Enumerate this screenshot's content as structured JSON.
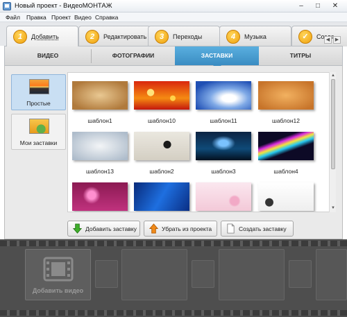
{
  "window": {
    "title": "Новый проект - ВидеоМОНТАЖ",
    "minimize_glyph": "–",
    "maximize_glyph": "□",
    "close_glyph": "✕"
  },
  "menu": {
    "items": [
      {
        "label": "Файл"
      },
      {
        "label": "Правка"
      },
      {
        "label": "Проект"
      },
      {
        "label": "Видео"
      },
      {
        "label": "Справка"
      }
    ]
  },
  "main_tabs": [
    {
      "number": "1",
      "label": "Добавить",
      "active": true
    },
    {
      "number": "2",
      "label": "Редактировать",
      "active": false
    },
    {
      "number": "3",
      "label": "Переходы",
      "active": false
    },
    {
      "number": "4",
      "label": "Музыка",
      "active": false
    },
    {
      "number": "",
      "label": "Созда",
      "active": false,
      "icon": "check-icon"
    }
  ],
  "tab_scroll": {
    "left_glyph": "◀",
    "right_glyph": "▶"
  },
  "sub_tabs": [
    {
      "label": "ВИДЕО",
      "active": false
    },
    {
      "label": "ФОТОГРАФИИ",
      "active": false
    },
    {
      "label": "ЗАСТАВКИ",
      "active": true
    },
    {
      "label": "ТИТРЫ",
      "active": false
    }
  ],
  "categories": [
    {
      "label": "Простые",
      "active": true,
      "icon": "sunset-thumbnail"
    },
    {
      "label": "Мои заставки",
      "active": false,
      "icon": "user-photo-thumbnail"
    }
  ],
  "templates": [
    {
      "label": "шаблон1"
    },
    {
      "label": "шаблон10"
    },
    {
      "label": "шаблон11"
    },
    {
      "label": "шаблон12"
    },
    {
      "label": "шаблон13"
    },
    {
      "label": "шаблон2"
    },
    {
      "label": "шаблон3"
    },
    {
      "label": "шаблон4"
    },
    {
      "label": ""
    },
    {
      "label": ""
    },
    {
      "label": ""
    },
    {
      "label": ""
    }
  ],
  "actions": {
    "add_intro": "Добавить заставку",
    "remove_from_project": "Убрать из проекта",
    "create_intro": "Создать заставку"
  },
  "timeline": {
    "add_video_label": "Добавить видео"
  },
  "colors": {
    "accent_blue": "#3a8cc2",
    "tab_number_orange": "#f0a10c",
    "timeline_bg": "#4e4e4e"
  }
}
